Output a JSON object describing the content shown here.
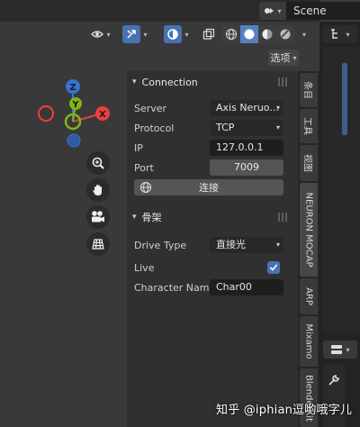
{
  "header": {
    "scene_name": "Scene",
    "options_label": "选项"
  },
  "panel_connection": {
    "title": "Connection",
    "server_label": "Server",
    "server_value": "Axis Neruo...",
    "protocol_label": "Protocol",
    "protocol_value": "TCP",
    "ip_label": "IP",
    "ip_value": "127.0.0.1",
    "port_label": "Port",
    "port_value": "7009",
    "connect_label": "连接"
  },
  "panel_skeleton": {
    "title": "骨架",
    "drive_type_label": "Drive Type",
    "drive_type_value": "直接光",
    "live_label": "Live",
    "live_checked": true,
    "character_name_label": "Character Name",
    "character_name_value": "Char00"
  },
  "tabs": [
    "条目",
    "工具",
    "视图",
    "NEURON MOCAP",
    "ARP",
    "Mixamo",
    "BlenderKit"
  ],
  "gizmo": {
    "z": "Z",
    "y": "Y",
    "x": "X"
  },
  "watermark": "知乎 @iphian逗哟哦字儿",
  "colors": {
    "accent": "#4772b3",
    "x_axis": "#e8403f",
    "y_axis": "#83b51a",
    "z_axis": "#3574d6"
  }
}
